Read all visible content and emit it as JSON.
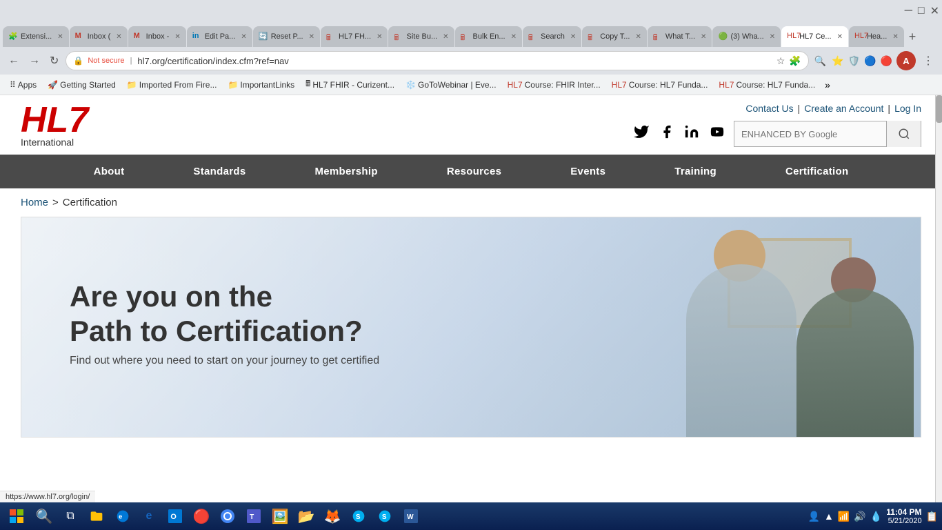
{
  "browser": {
    "tabs": [
      {
        "id": "t1",
        "favicon": "🧩",
        "label": "Extensi...",
        "active": false
      },
      {
        "id": "t2",
        "favicon": "M",
        "label": "Inbox (",
        "active": false
      },
      {
        "id": "t3",
        "favicon": "M",
        "label": "Inbox -",
        "active": false
      },
      {
        "id": "t4",
        "favicon": "in",
        "label": "Edit Pa...",
        "active": false
      },
      {
        "id": "t5",
        "favicon": "🔄",
        "label": "Reset P...",
        "active": false
      },
      {
        "id": "t6",
        "favicon": "🖩",
        "label": "HL7 FH...",
        "active": false
      },
      {
        "id": "t7",
        "favicon": "🖩",
        "label": "Site Bu...",
        "active": false
      },
      {
        "id": "t8",
        "favicon": "🖩",
        "label": "Bulk En...",
        "active": false
      },
      {
        "id": "t9",
        "favicon": "🖩",
        "label": "Search",
        "active": false
      },
      {
        "id": "t10",
        "favicon": "🖩",
        "label": "Copy T...",
        "active": false
      },
      {
        "id": "t11",
        "favicon": "🖩",
        "label": "What T...",
        "active": false
      },
      {
        "id": "t12",
        "favicon": "🟢",
        "label": "(3) Wha...",
        "active": false
      },
      {
        "id": "t13",
        "favicon": "🏥",
        "label": "HL7 Ce...",
        "active": true
      },
      {
        "id": "t14",
        "favicon": "🏥",
        "label": "Hea...",
        "active": false
      }
    ],
    "address": "hl7.org/certification/index.cfm?ref=nav",
    "protocol": "Not secure",
    "status_bar": "https://www.hl7.org/login/"
  },
  "bookmarks": [
    {
      "icon": "🔲",
      "label": "Apps",
      "chevron": false
    },
    {
      "icon": "🚀",
      "label": "Getting Started",
      "chevron": false
    },
    {
      "icon": "📁",
      "label": "Imported From Fire...",
      "chevron": false
    },
    {
      "icon": "📁",
      "label": "ImportantLinks",
      "chevron": false
    },
    {
      "icon": "🖩",
      "label": "HL7 FHIR - Curizent...",
      "chevron": false
    },
    {
      "icon": "❄️",
      "label": "GoToWebinar | Eve...",
      "chevron": false
    },
    {
      "icon": "🏥",
      "label": "Course: FHIR Inter...",
      "chevron": false
    },
    {
      "icon": "🏥",
      "label": "Course: HL7 Funda...",
      "chevron": false
    },
    {
      "icon": "🏥",
      "label": "Course: HL7 Funda...",
      "chevron": false
    }
  ],
  "header": {
    "logo_hl7": "HL7",
    "logo_intl": "International",
    "contact_us": "Contact Us",
    "create_account": "Create an Account",
    "log_in": "Log In",
    "search_placeholder": "ENHANCED BY Google",
    "social": {
      "twitter": "🐦",
      "facebook": "f",
      "linkedin": "in",
      "youtube": "▶"
    }
  },
  "nav": {
    "items": [
      {
        "id": "about",
        "label": "About"
      },
      {
        "id": "standards",
        "label": "Standards"
      },
      {
        "id": "membership",
        "label": "Membership"
      },
      {
        "id": "resources",
        "label": "Resources"
      },
      {
        "id": "events",
        "label": "Events"
      },
      {
        "id": "training",
        "label": "Training"
      },
      {
        "id": "certification",
        "label": "Certification"
      }
    ]
  },
  "breadcrumb": {
    "home": "Home",
    "separator": ">",
    "current": "Certification"
  },
  "hero": {
    "title_line1": "Are you on the",
    "title_line2": "Path to Certification?",
    "subtitle": "Find out where you need to start on your journey to get certified"
  },
  "taskbar": {
    "start_icon": "⊞",
    "app_icons": [
      {
        "id": "search",
        "icon": "🔍"
      },
      {
        "id": "taskview",
        "icon": "⧉"
      },
      {
        "id": "file-explorer",
        "icon": "📁"
      },
      {
        "id": "edge",
        "icon": "🌐"
      },
      {
        "id": "ie",
        "icon": "e"
      },
      {
        "id": "outlook",
        "icon": "📧"
      },
      {
        "id": "icon7",
        "icon": "🔴"
      },
      {
        "id": "chrome",
        "icon": "🔵"
      },
      {
        "id": "teams",
        "icon": "💼"
      },
      {
        "id": "photos",
        "icon": "🖼️"
      },
      {
        "id": "files",
        "icon": "📂"
      },
      {
        "id": "firefox",
        "icon": "🦊"
      },
      {
        "id": "skype1",
        "icon": "💬"
      },
      {
        "id": "skype2",
        "icon": "🎭"
      },
      {
        "id": "word",
        "icon": "W"
      }
    ],
    "sys_icons": [
      "👤",
      "🔺",
      "📶",
      "🔊",
      "💧"
    ],
    "clock_time": "11:04 PM",
    "clock_date": "5/21/2020",
    "notif_icon": "📋"
  }
}
